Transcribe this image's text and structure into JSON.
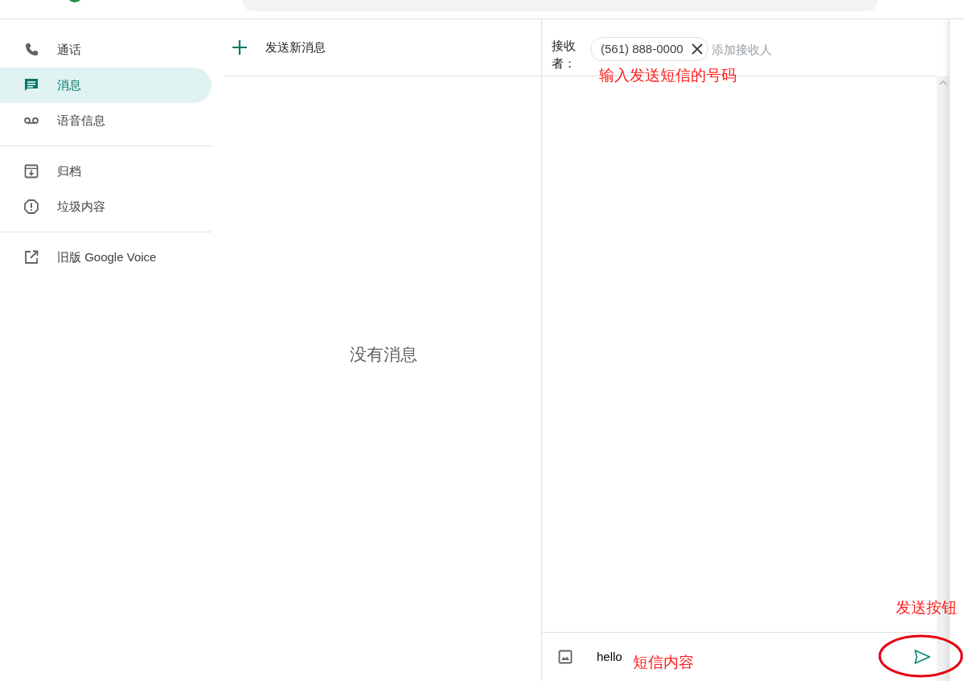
{
  "sidebar": {
    "sections": [
      {
        "items": [
          {
            "label": "通话",
            "selected": false
          },
          {
            "label": "消息",
            "selected": true
          },
          {
            "label": "语音信息",
            "selected": false
          }
        ]
      },
      {
        "items": [
          {
            "label": "归档",
            "selected": false
          },
          {
            "label": "垃圾内容",
            "selected": false
          }
        ]
      },
      {
        "items": [
          {
            "label": "旧版 Google Voice",
            "selected": false
          }
        ]
      }
    ]
  },
  "message_list": {
    "new_message": "发送新消息",
    "empty_text": "没有消息"
  },
  "conversation": {
    "recipient_label": "接收者：",
    "recipients": [
      {
        "number": "(561) 888-0000"
      }
    ],
    "add_placeholder": "添加接收人",
    "message_value": "hello"
  },
  "annotations": [
    {
      "text": "输入发送短信的号码",
      "kind": "text"
    },
    {
      "text": "短信内容",
      "kind": "text"
    },
    {
      "text": "发送按钮",
      "kind": "text"
    },
    {
      "kind": "ellipse",
      "color": "#e60012"
    }
  ]
}
